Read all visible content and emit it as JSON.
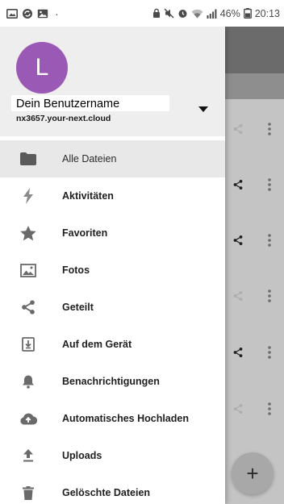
{
  "status_bar": {
    "left_icons": [
      "gallery-icon",
      "sync-icon",
      "photo-icon"
    ],
    "dot": "·",
    "right_icons": [
      "lock-icon",
      "mute-icon",
      "alarm-icon",
      "wifi-icon",
      "signal-icon"
    ],
    "battery": "46%",
    "time": "20:13"
  },
  "account": {
    "avatar_letter": "L",
    "avatar_color": "#9b59b6",
    "username": "Dein Benutzername",
    "server": "nx3657.your-next.cloud",
    "dropdown_icon": "arrow-drop-down-icon"
  },
  "menu": {
    "items": [
      {
        "label": "Alle Dateien",
        "icon": "folder-icon",
        "active": true
      },
      {
        "label": "Aktivitäten",
        "icon": "lightning-icon",
        "active": false
      },
      {
        "label": "Favoriten",
        "icon": "star-icon",
        "active": false
      },
      {
        "label": "Fotos",
        "icon": "image-icon",
        "active": false
      },
      {
        "label": "Geteilt",
        "icon": "share-icon",
        "active": false
      },
      {
        "label": "Auf dem Gerät",
        "icon": "device-download-icon",
        "active": false
      },
      {
        "label": "Benachrichtigungen",
        "icon": "bell-icon",
        "active": false
      },
      {
        "label": "Automatisches Hochladen",
        "icon": "cloud-upload-icon",
        "active": false
      },
      {
        "label": "Uploads",
        "icon": "upload-icon",
        "active": false
      },
      {
        "label": "Gelöschte Dateien",
        "icon": "trash-icon",
        "active": false
      }
    ]
  },
  "background": {
    "fab_label": "+",
    "row_icons": [
      "share-icon",
      "more-vertical-icon"
    ]
  },
  "colors": {
    "accent": "#9b59b6",
    "active_item_bg": "#e8e8e8",
    "scrim": "#c4c4c4"
  }
}
